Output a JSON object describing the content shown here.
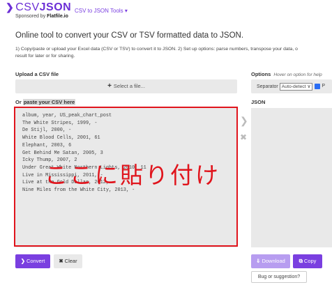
{
  "header": {
    "logo_text": "CSV",
    "logo_bold": "JSON",
    "sponsor_prefix": "Sponsored by ",
    "sponsor_name": "Flatfile.io",
    "nav": [
      {
        "label": "CSV to JSON"
      },
      {
        "label": "Tools ▾"
      }
    ]
  },
  "main": {
    "headline": "Online tool to convert your CSV or TSV formatted data to JSON.",
    "description": "1) Copy/paste or upload your Excel data (CSV or TSV) to convert it to JSON. 2) Set up options: parse numbers, transpose your data, o",
    "description_line2": "result for later or for sharing."
  },
  "upload": {
    "label": "Upload a CSV file",
    "select_file": "Select a file..."
  },
  "options": {
    "label": "Options",
    "hint": "Hover on option for help",
    "separator_label": "Separator",
    "separator_value": "Auto-detect ∨",
    "parse_letter": "P"
  },
  "paste": {
    "label_prefix": "Or ",
    "label_highlight": "paste your CSV here",
    "content": "album, year, US_peak_chart_post\nThe White Stripes, 1999, -\nDe Stijl, 2000, -\nWhite Blood Cells, 2001, 61\nElephant, 2003, 6\nGet Behind Me Satan, 2005, 3\nIcky Thump, 2007, 2\nUnder Great White Northern Lights, 2010, 11\nLive in Mississippi, 2011, -\nLive at the Gold Dollar, 2012, -\nNine Miles from the White City, 2013, -",
    "overlay_text": "ここに貼り付け"
  },
  "json_panel": {
    "label": "JSON"
  },
  "buttons": {
    "convert": "Convert",
    "clear": "Clear",
    "download": "Download",
    "copy": "Copy",
    "bug": "Bug or suggestion?"
  },
  "icons": {
    "convert": "chevron-right-icon",
    "clear": "close-icon",
    "download": "download-icon",
    "copy": "copy-icon",
    "select_file": "plus-icon"
  },
  "colors": {
    "brand": "#7a3fe0",
    "highlight": "#e0141c"
  }
}
